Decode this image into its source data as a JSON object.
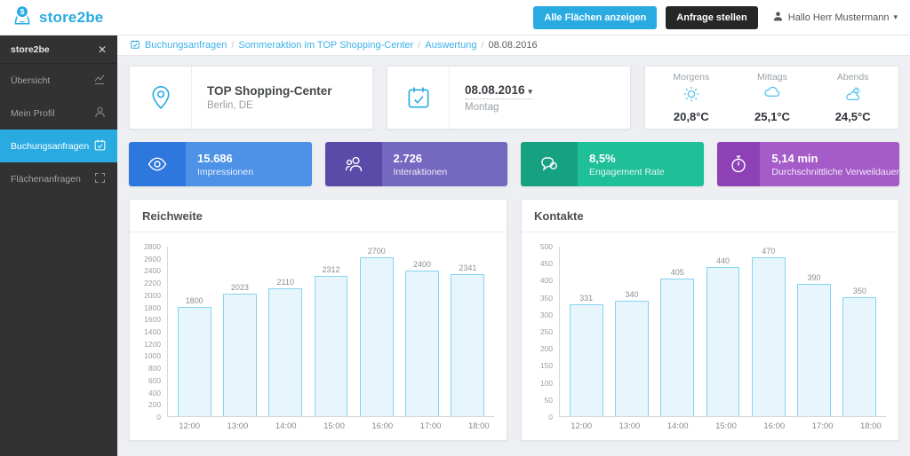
{
  "brand": {
    "color": "#29abe2",
    "logo_text": "store2be"
  },
  "topbar": {
    "show_spaces_button": "Alle Flächen anzeigen",
    "request_button": "Anfrage stellen",
    "user_label": "Hallo Herr Mustermann"
  },
  "sidebar": {
    "title": "store2be",
    "close_icon": "✕",
    "items": [
      {
        "label": "Übersicht",
        "icon": "line-chart"
      },
      {
        "label": "Mein Profil",
        "icon": "user"
      },
      {
        "label": "Buchungsanfragen",
        "icon": "calendar-check",
        "active": true
      },
      {
        "label": "Flächenanfragen",
        "icon": "expand"
      }
    ]
  },
  "breadcrumb": {
    "items": [
      "Buchungsanfragen",
      "Sommeraktion im TOP Shopping-Center",
      "Auswertung",
      "08.08.2016"
    ]
  },
  "info_cards": {
    "location": {
      "title": "TOP Shopping-Center",
      "subtitle": "Berlin, DE"
    },
    "date": {
      "value": "08.08.2016",
      "caret": "▾",
      "subtitle": "Montag"
    },
    "weather": [
      {
        "label": "Morgens",
        "icon": "sun",
        "temp": "20,8°C"
      },
      {
        "label": "Mittags",
        "icon": "rain-cloud",
        "temp": "25,1°C"
      },
      {
        "label": "Abends",
        "icon": "sun-cloud",
        "temp": "24,5°C"
      }
    ]
  },
  "kpis": [
    {
      "value": "15.686",
      "label": "Impressionen",
      "icon": "eye",
      "color_dark": "#2e77dc",
      "color_light": "#4d92e7"
    },
    {
      "value": "2.726",
      "label": "Interaktionen",
      "icon": "people",
      "color_dark": "#5a4ba8",
      "color_light": "#7568c0"
    },
    {
      "value": "8,5%",
      "label": "Engagement Rate",
      "icon": "chat-bubbles",
      "color_dark": "#16a181",
      "color_light": "#1fbf98"
    },
    {
      "value": "5,14 min",
      "label": "Durchschnittliche Verweildauer",
      "icon": "stopwatch",
      "color_dark": "#8e41b5",
      "color_light": "#a55bc8"
    }
  ],
  "chart_data": [
    {
      "type": "bar",
      "title": "Reichweite",
      "categories": [
        "12:00",
        "13:00",
        "14:00",
        "15:00",
        "16:00",
        "17:00",
        "18:00"
      ],
      "values": [
        1800,
        2023,
        2110,
        2312,
        2700,
        2400,
        2341
      ],
      "xlabel": "",
      "ylabel": "",
      "ylim": [
        0,
        2800
      ],
      "ytick_step": 200,
      "grid": false,
      "legend": false,
      "bar_fill": "#e7f5fc",
      "bar_border": "#85d4f2"
    },
    {
      "type": "bar",
      "title": "Kontakte",
      "categories": [
        "12:00",
        "13:00",
        "14:00",
        "15:00",
        "16:00",
        "17:00",
        "18:00"
      ],
      "values": [
        331,
        340,
        405,
        440,
        470,
        390,
        350
      ],
      "xlabel": "",
      "ylabel": "",
      "ylim": [
        0,
        500
      ],
      "ytick_step": 50,
      "grid": false,
      "legend": false,
      "bar_fill": "#e7f5fc",
      "bar_border": "#85d4f2"
    }
  ]
}
